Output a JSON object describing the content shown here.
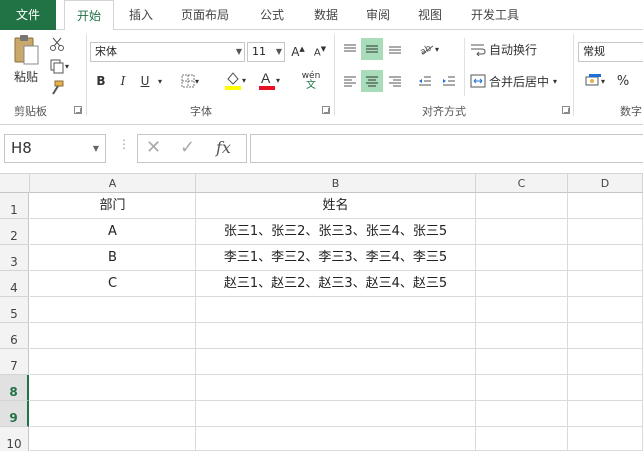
{
  "ribbon_tabs": [
    "文件",
    "开始",
    "插入",
    "页面布局",
    "公式",
    "数据",
    "审阅",
    "视图",
    "开发工具"
  ],
  "ribbon": {
    "paste_label": "粘贴",
    "clipboard_group": "剪贴板",
    "font_name": "宋体",
    "font_size": "11",
    "bold": "B",
    "italic": "I",
    "underline": "U",
    "phonetic": "wén",
    "font_group": "字体",
    "wrap_text": "自动换行",
    "merge_center": "合并后居中",
    "alignment_group": "对齐方式",
    "number_format": "常规",
    "percent": "%",
    "number_group": "数字"
  },
  "formula_bar": {
    "name_box": "H8",
    "cancel": "✕",
    "enter": "✓",
    "fx": "fx",
    "formula": ""
  },
  "sheet": {
    "columns": [
      "A",
      "B",
      "C",
      "D"
    ],
    "rows": [
      "1",
      "2",
      "3",
      "4",
      "5",
      "6",
      "7",
      "8",
      "9",
      "10"
    ],
    "cells": [
      [
        "部门",
        "姓名"
      ],
      [
        "A",
        "张三1、张三2、张三3、张三4、张三5"
      ],
      [
        "B",
        "李三1、李三2、李三3、李三4、李三5"
      ],
      [
        "C",
        "赵三1、赵三2、赵三3、赵三4、赵三5"
      ]
    ],
    "selected_rows": [
      "8",
      "9"
    ]
  },
  "colors": {
    "accent": "#217346",
    "highlight_yellow": "#ffff00",
    "font_red": "#e81123"
  }
}
